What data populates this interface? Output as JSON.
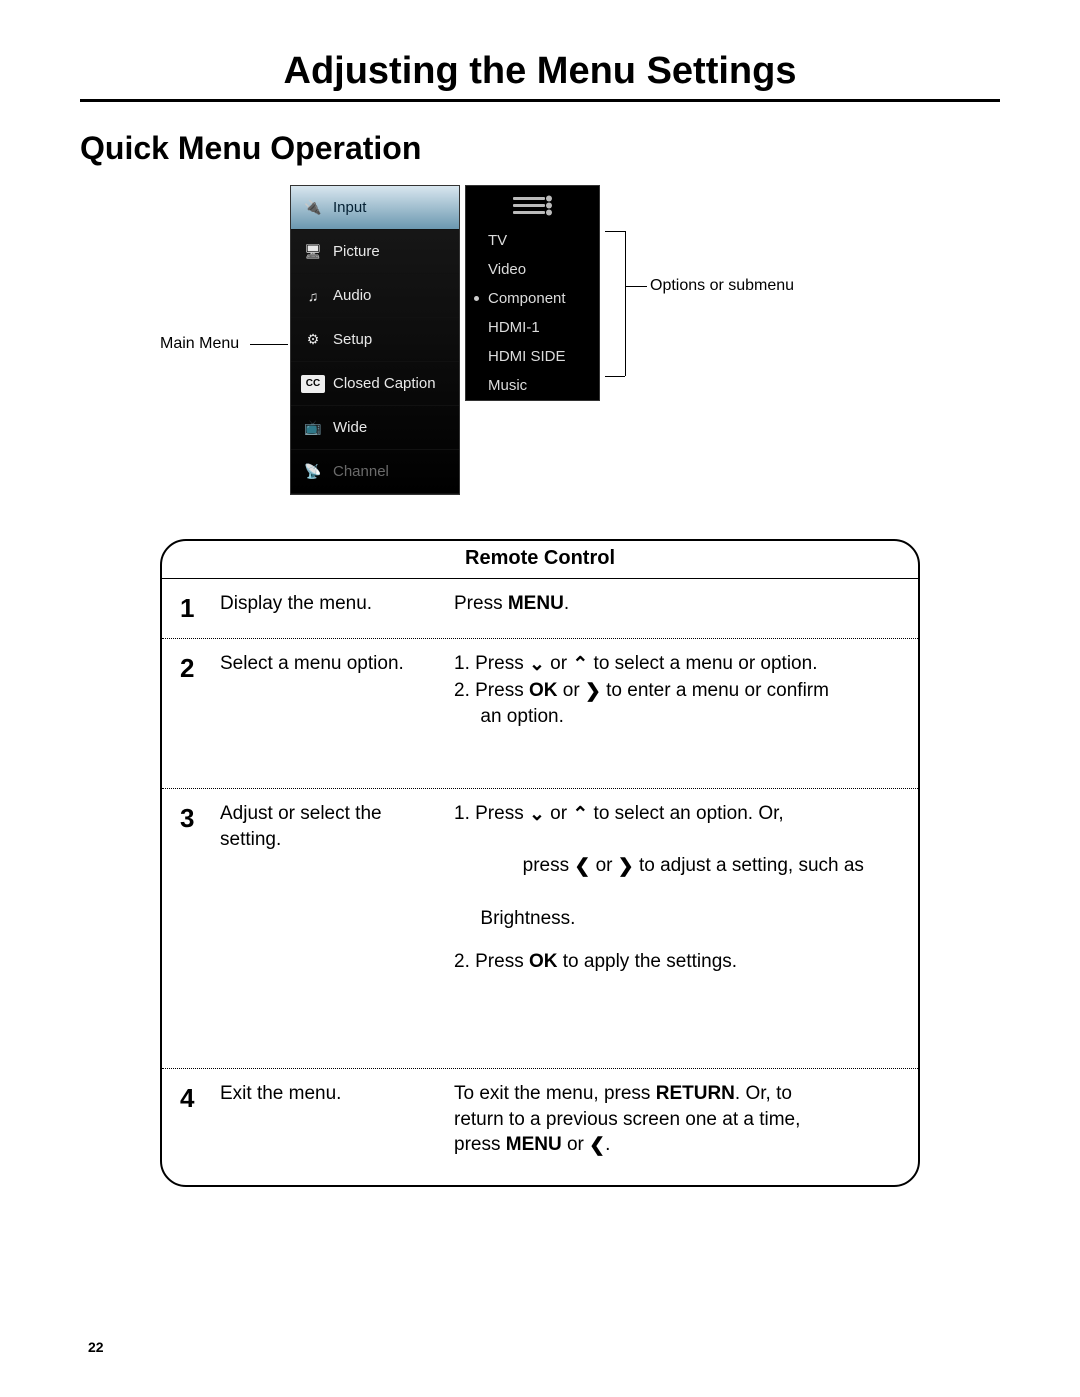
{
  "title": "Adjusting the Menu Settings",
  "section": "Quick Menu Operation",
  "callouts": {
    "main_menu": "Main Menu",
    "submenu": "Options or submenu"
  },
  "tv_menu": {
    "items": [
      {
        "label": "Input",
        "icon": "input-icon",
        "selected": true
      },
      {
        "label": "Picture",
        "icon": "picture-icon",
        "selected": false
      },
      {
        "label": "Audio",
        "icon": "audio-icon",
        "selected": false
      },
      {
        "label": "Setup",
        "icon": "setup-icon",
        "selected": false
      },
      {
        "label": "Closed Caption",
        "icon": "cc-icon",
        "selected": false
      },
      {
        "label": "Wide",
        "icon": "wide-icon",
        "selected": false
      },
      {
        "label": "Channel",
        "icon": "channel-icon",
        "selected": false,
        "dim": true
      }
    ],
    "sub_items": [
      {
        "label": "TV"
      },
      {
        "label": "Video"
      },
      {
        "label": "Component",
        "selected": true
      },
      {
        "label": "HDMI-1"
      },
      {
        "label": "HDMI SIDE"
      },
      {
        "label": "Music"
      }
    ]
  },
  "rc_header": "Remote Control",
  "steps": {
    "1": {
      "num": "1",
      "action": "Display the menu.",
      "remote_prefix": "Press ",
      "remote_btn": "MENU",
      "remote_suffix": "."
    },
    "2": {
      "num": "2",
      "action": "Select a menu option.",
      "l1a": "1.  Press ",
      "l1b": " or ",
      "l1c": " to select a menu or option.",
      "l2a": "2.  Press ",
      "l2_ok": "OK",
      "l2b": " or ",
      "l2c": " to enter a menu or confirm",
      "l2d": "     an option."
    },
    "3": {
      "num": "3",
      "action": "Adjust or select the setting.",
      "l1a": "1.  Press ",
      "l1b": " or ",
      "l1c": " to select an option. Or,",
      "l1d": "     press ",
      "l1e": " or ",
      "l1f": " to adjust a setting, such as",
      "l1g": "     Brightness.",
      "l2a": "2.  Press ",
      "l2_ok": "OK",
      "l2b": "  to apply the settings."
    },
    "4": {
      "num": "4",
      "action": "Exit the menu.",
      "l1a": "To exit the menu, press ",
      "l1_return": "RETURN",
      "l1b": ". Or, to",
      "l2": "return to a previous screen one at a time,",
      "l3a": "press ",
      "l3_menu": "MENU",
      "l3b": " or ",
      "l3c": "."
    }
  },
  "page_number": "22"
}
